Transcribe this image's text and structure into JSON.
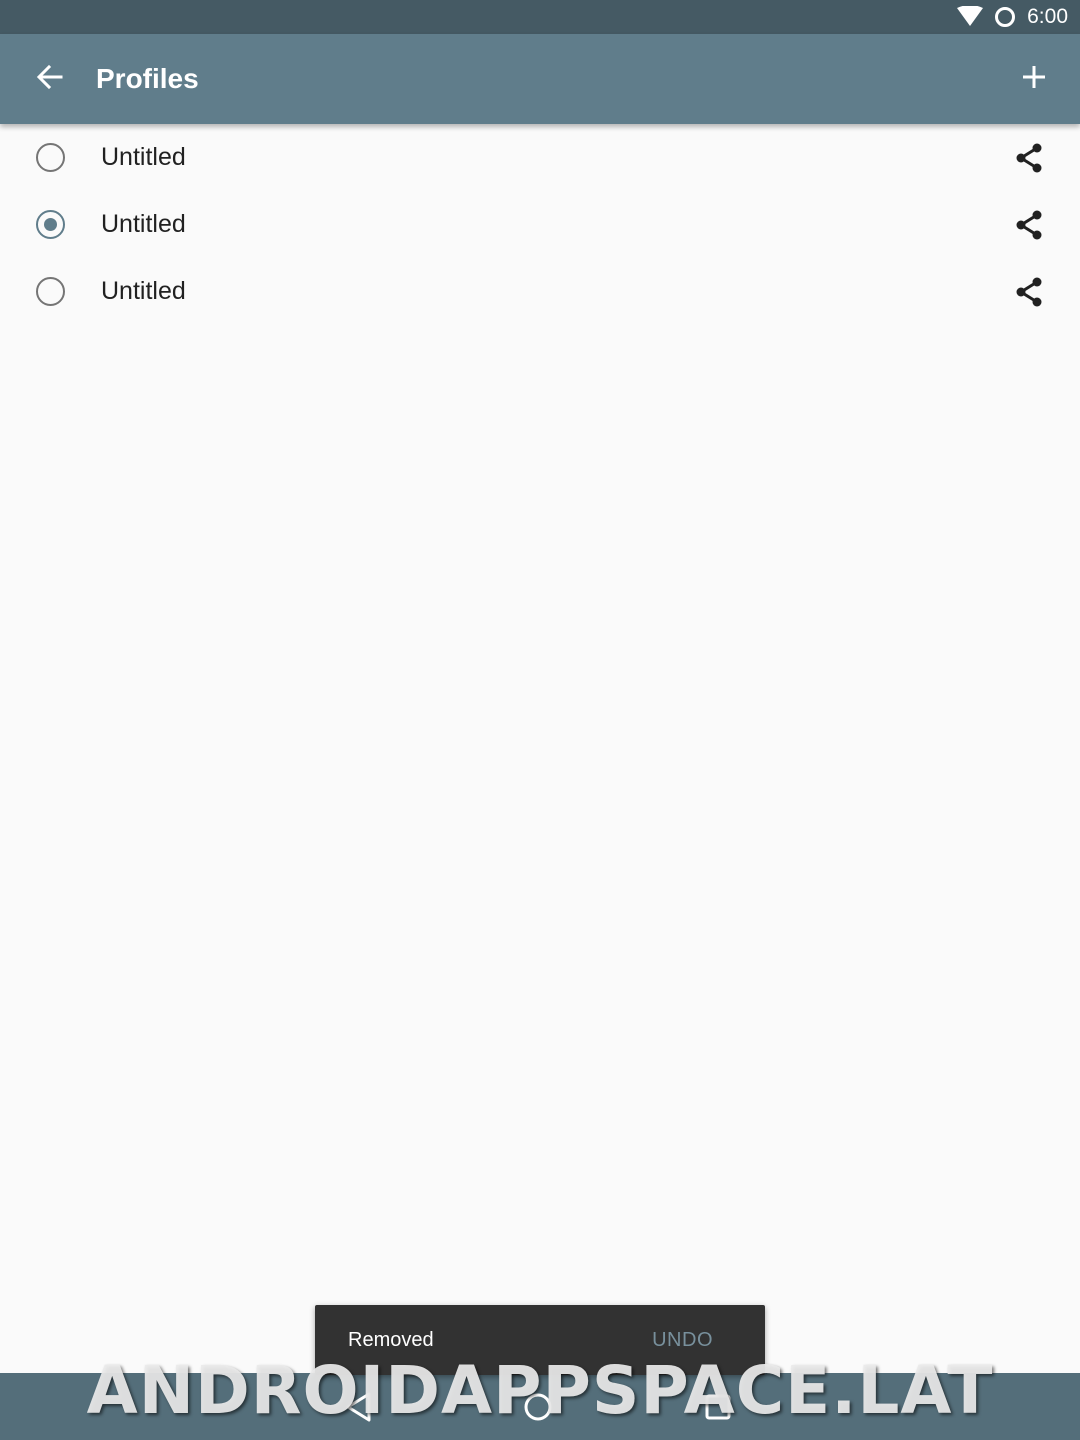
{
  "status_bar": {
    "time": "6:00",
    "icons": [
      "wifi-icon",
      "sync-icon"
    ]
  },
  "app_bar": {
    "title": "Profiles",
    "back_icon": "arrow-back-icon",
    "add_icon": "plus-icon"
  },
  "profiles": [
    {
      "name": "Untitled",
      "selected": false
    },
    {
      "name": "Untitled",
      "selected": true
    },
    {
      "name": "Untitled",
      "selected": false
    }
  ],
  "snackbar": {
    "message": "Removed",
    "action": "UNDO"
  },
  "nav_bar": {
    "icons": [
      "back-triangle-icon",
      "home-circle-icon",
      "recents-square-icon"
    ]
  },
  "watermark": "ANDROIDAPPSPACE.LAT",
  "colors": {
    "status_bar": "#455a64",
    "app_bar": "#607d8b",
    "accent": "#607d8b",
    "background": "#fafafa",
    "snackbar": "#323232",
    "snackbar_action": "#78909c",
    "nav_bar": "#546e7a"
  }
}
